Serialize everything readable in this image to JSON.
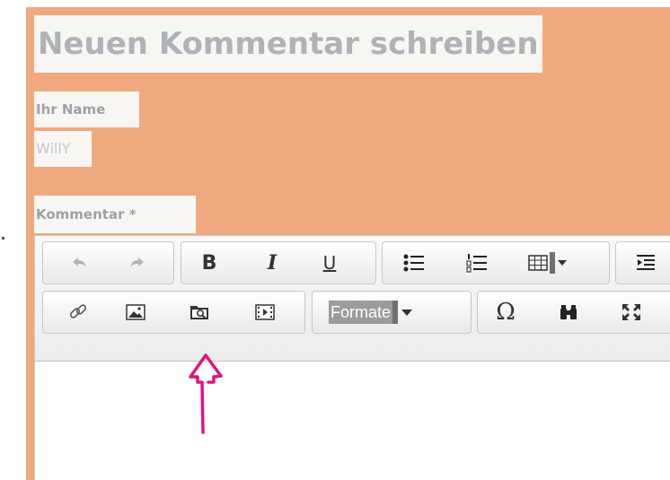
{
  "form": {
    "title": "Neuen Kommentar schreiben",
    "name_label": "Ihr Name",
    "name_value": "WillY",
    "comment_label": "Kommentar *"
  },
  "toolbar": {
    "row1": [
      {
        "icon": "undo-icon",
        "disabled": true
      },
      {
        "icon": "redo-icon",
        "disabled": true
      },
      {
        "icon": "bold-icon",
        "text": "B"
      },
      {
        "icon": "italic-icon",
        "text": "I"
      },
      {
        "icon": "underline-icon",
        "text": "U"
      },
      {
        "icon": "bulleted-list-icon"
      },
      {
        "icon": "numbered-list-icon"
      },
      {
        "icon": "table-icon"
      },
      {
        "icon": "indent-icon"
      }
    ],
    "row2": [
      {
        "icon": "link-icon"
      },
      {
        "icon": "image-icon"
      },
      {
        "icon": "file-browser-icon"
      },
      {
        "icon": "media-icon"
      },
      {
        "icon": "special-char-icon",
        "text": "Ω"
      },
      {
        "icon": "find-icon"
      },
      {
        "icon": "maximize-icon"
      }
    ],
    "format_dropdown": "Formate"
  },
  "colors": {
    "page_bg": "#f0a97e",
    "annotation_arrow": "#e0157a"
  }
}
